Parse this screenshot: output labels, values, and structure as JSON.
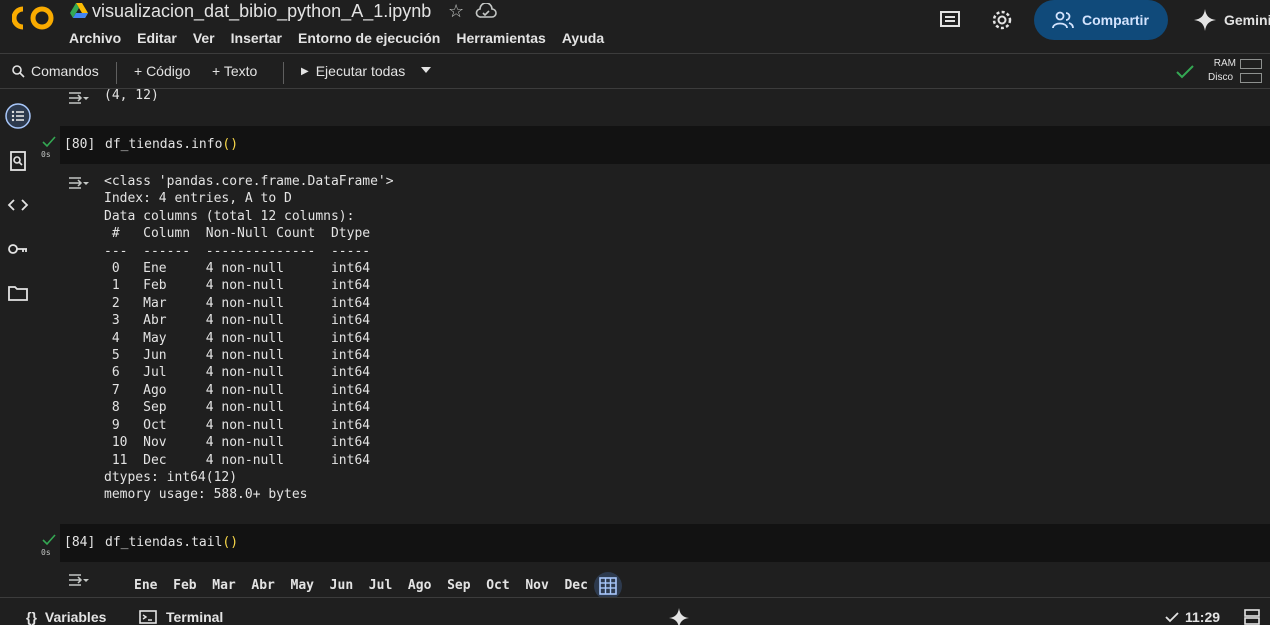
{
  "header": {
    "logo_text": "CO",
    "file_title": "visualizacion_dat_bibio_python_A_1.ipynb",
    "menu": [
      "Archivo",
      "Editar",
      "Ver",
      "Insertar",
      "Entorno de ejecución",
      "Herramientas",
      "Ayuda"
    ],
    "share_label": "Compartir",
    "gemini_label": "Gemini"
  },
  "toolbar": {
    "commands_label": "Comandos",
    "code_label": "+ Código",
    "text_label": "+ Texto",
    "run_all_label": "Ejecutar todas",
    "ram_label": "RAM",
    "disk_label": "Disco"
  },
  "cells": {
    "prev_output": "(4, 12)",
    "cell1": {
      "exec_count": "[80]",
      "code": "df_tiendas.info",
      "paren": "()",
      "time": "0s",
      "output": "<class 'pandas.core.frame.DataFrame'>\nIndex: 4 entries, A to D\nData columns (total 12 columns):\n #   Column  Non-Null Count  Dtype\n---  ------  --------------  -----\n 0   Ene     4 non-null      int64\n 1   Feb     4 non-null      int64\n 2   Mar     4 non-null      int64\n 3   Abr     4 non-null      int64\n 4   May     4 non-null      int64\n 5   Jun     4 non-null      int64\n 6   Jul     4 non-null      int64\n 7   Ago     4 non-null      int64\n 8   Sep     4 non-null      int64\n 9   Oct     4 non-null      int64\n 10  Nov     4 non-null      int64\n 11  Dec     4 non-null      int64\ndtypes: int64(12)\nmemory usage: 588.0+ bytes"
    },
    "cell2": {
      "exec_count": "[84]",
      "code": "df_tiendas.tail",
      "paren": "()",
      "time": "0s",
      "columns": "Ene  Feb  Mar  Abr  May  Jun  Jul  Ago  Sep  Oct  Nov  Dec"
    }
  },
  "status": {
    "variables_label": "Variables",
    "terminal_label": "Terminal",
    "time": "11:29"
  }
}
